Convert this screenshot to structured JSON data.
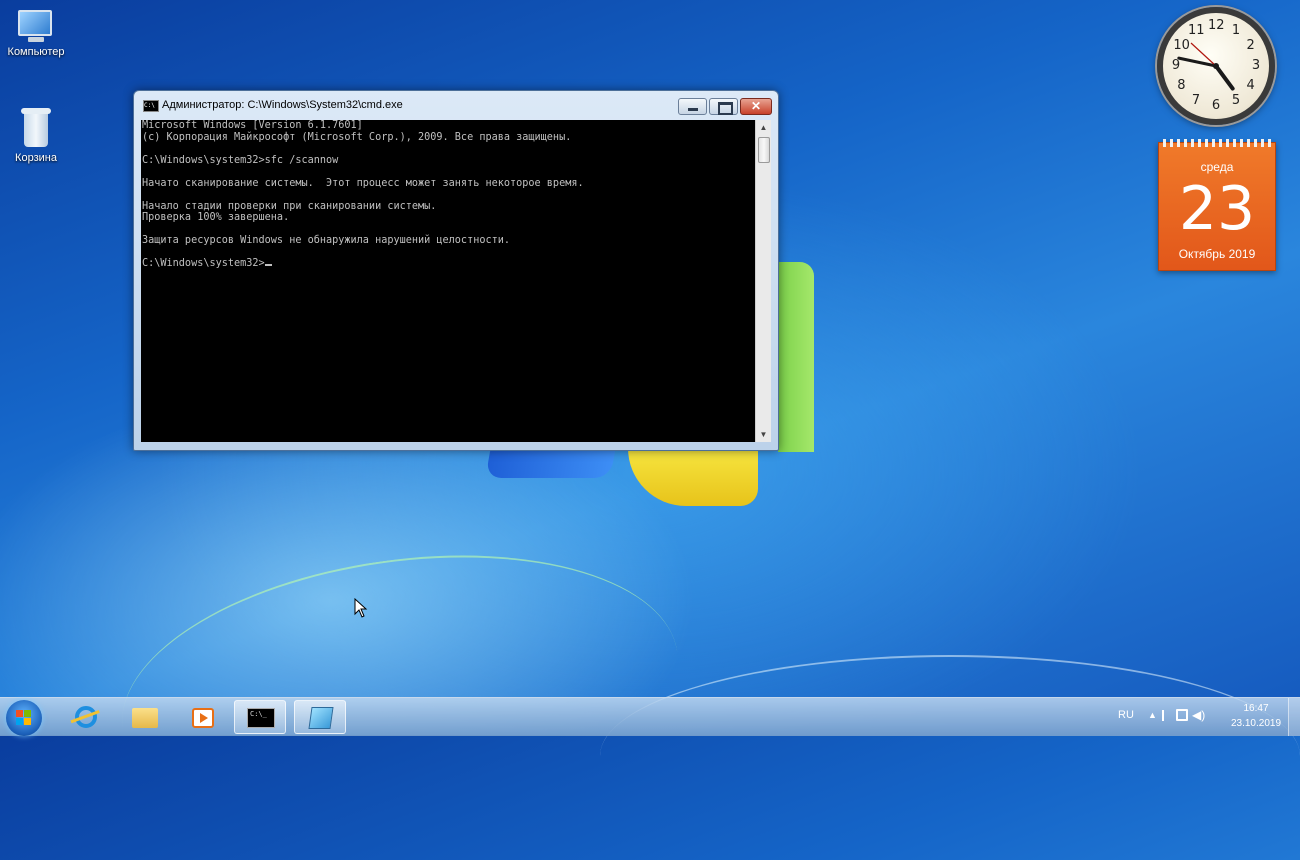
{
  "desktop": {
    "icons": [
      {
        "label": "Компьютер",
        "icon": "computer-icon"
      },
      {
        "label": "Корзина",
        "icon": "recycle-bin-icon"
      }
    ]
  },
  "cmd_window": {
    "title": "Администратор: C:\\Windows\\System32\\cmd.exe",
    "close_label": "✕",
    "lines": [
      "Microsoft Windows [Version 6.1.7601]",
      "(c) Корпорация Майкрософт (Microsoft Corp.), 2009. Все права защищены.",
      "",
      "C:\\Windows\\system32>sfc /scannow",
      "",
      "Начато сканирование системы.  Этот процесс может занять некоторое время.",
      "",
      "Начало стадии проверки при сканировании системы.",
      "Проверка 100% завершена.",
      "",
      "Защита ресурсов Windows не обнаружила нарушений целостности.",
      "",
      "C:\\Windows\\system32>"
    ]
  },
  "clock_gadget": {
    "numbers": [
      "12",
      "1",
      "2",
      "3",
      "4",
      "5",
      "6",
      "7",
      "8",
      "9",
      "10",
      "11"
    ],
    "time": "16:47"
  },
  "calendar_gadget": {
    "weekday": "среда",
    "day": "23",
    "month_year": "Октябрь 2019"
  },
  "taskbar": {
    "pinned": [
      {
        "name": "internet-explorer",
        "icon": "ie-icon"
      },
      {
        "name": "explorer",
        "icon": "folder-icon"
      },
      {
        "name": "media-player",
        "icon": "media-player-icon"
      },
      {
        "name": "cmd",
        "icon": "cmd-icon",
        "label": "C:\\_",
        "active": true
      },
      {
        "name": "sticky-notes",
        "icon": "notes-icon"
      }
    ],
    "tray": {
      "language": "RU",
      "time": "16:47",
      "date": "23.10.2019"
    }
  },
  "colors": {
    "accent": "#1565c8",
    "calendar": "#e8631f",
    "console_bg": "#000000",
    "console_fg": "#c0c0c0"
  }
}
